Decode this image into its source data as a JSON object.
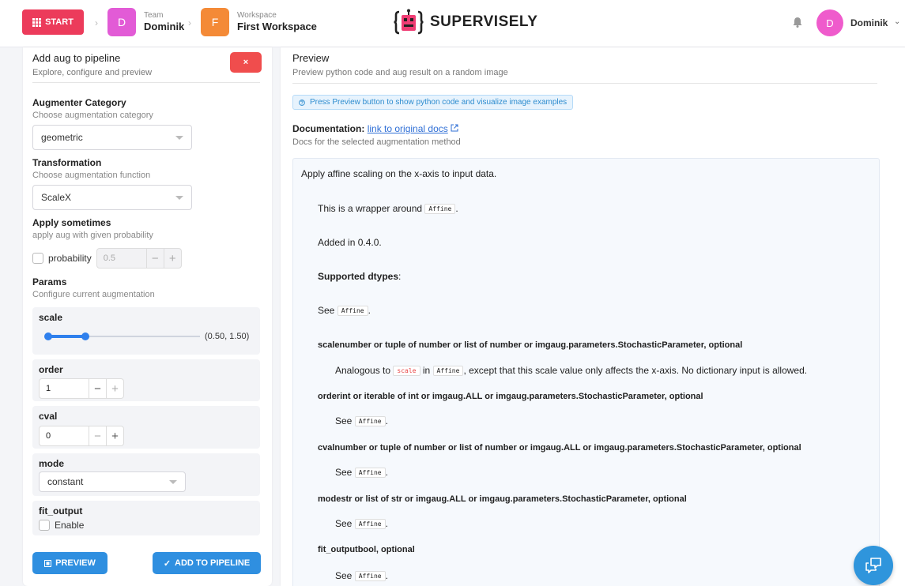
{
  "topbar": {
    "start_label": "START",
    "team": {
      "avatar_letter": "D",
      "small": "Team",
      "name": "Dominik"
    },
    "workspace": {
      "avatar_letter": "F",
      "small": "Workspace",
      "name": "First Workspace"
    },
    "logo_text": "SUPERVISELY",
    "user": {
      "avatar_letter": "D",
      "name": "Dominik"
    }
  },
  "left": {
    "title": "Add aug to pipeline",
    "subtitle": "Explore, configure and preview",
    "close_label": "×",
    "category": {
      "title": "Augmenter Category",
      "subtitle": "Choose augmentation category",
      "value": "geometric"
    },
    "transformation": {
      "title": "Transformation",
      "subtitle": "Choose augmentation function",
      "value": "ScaleX"
    },
    "sometimes": {
      "title": "Apply sometimes",
      "subtitle": "apply aug with given probability",
      "checkbox_label": "probability",
      "value": "0.5"
    },
    "params": {
      "title": "Params",
      "subtitle": "Configure current augmentation"
    },
    "scale": {
      "label": "scale",
      "value": "(0.50, 1.50)",
      "low": 0.5,
      "high": 1.5,
      "min": 0.5,
      "max": 5
    },
    "order": {
      "label": "order",
      "value": "1"
    },
    "cval": {
      "label": "cval",
      "value": "0"
    },
    "mode": {
      "label": "mode",
      "value": "constant"
    },
    "fit_output": {
      "label": "fit_output",
      "checkbox_label": "Enable"
    },
    "preview_label": "PREVIEW",
    "add_label": "ADD TO PIPELINE"
  },
  "right": {
    "title": "Preview",
    "subtitle": "Preview python code and aug result on a random image",
    "notice": "Press Preview button to show python code and visualize image examples",
    "doc_label": "Documentation:",
    "doc_link": "link to original docs",
    "doc_sub": "Docs for the selected augmentation method",
    "doc": {
      "intro": "Apply affine scaling on the x-axis to input data.",
      "wrapper_pre": "This is a wrapper around",
      "affine": "Affine",
      "added": "Added in 0.4.0.",
      "dtypes": "Supported dtypes",
      "see": "See",
      "p_scale": "scalenumber or tuple of number or list of number or imgaug.parameters.StochasticParameter, optional",
      "scale_pre": "Analogous to",
      "scale_code": "scale",
      "scale_in": "in",
      "scale_post": ", except that this scale value only affects the x-axis. No dictionary input is allowed.",
      "p_order": "orderint or iterable of int or imgaug.ALL or imgaug.parameters.StochasticParameter, optional",
      "p_cval": "cvalnumber or tuple of number or list of number or imgaug.ALL or imgaug.parameters.StochasticParameter, optional",
      "p_mode": "modestr or list of str or imgaug.ALL or imgaug.parameters.StochasticParameter, optional",
      "p_fit": "fit_outputbool, optional"
    }
  },
  "colors": {
    "accent": "#2f8fe0",
    "danger": "#f04d4d",
    "start": "#ec3b5b"
  }
}
